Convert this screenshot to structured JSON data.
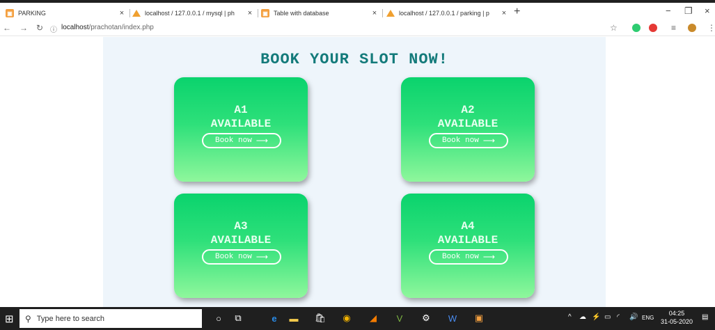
{
  "browser": {
    "tabs": [
      {
        "label": "PARKING",
        "icon": "page-favicon",
        "close": "×"
      },
      {
        "label": "localhost / 127.0.0.1 / mysql | ph",
        "icon": "phpmyadmin-favicon",
        "close": "×"
      },
      {
        "label": "Table with database",
        "icon": "page-favicon",
        "close": "×"
      },
      {
        "label": "localhost / 127.0.0.1 / parking | p",
        "icon": "phpmyadmin-favicon",
        "close": "×"
      }
    ],
    "new_tab": "+",
    "window_controls": {
      "minimize": "−",
      "maximize": "❐",
      "close": "×"
    },
    "address": {
      "host": "localhost",
      "path": "/prachotan/index.php"
    }
  },
  "page": {
    "heading": "BOOK YOUR SLOT NOW!",
    "slots": [
      {
        "id": "A1",
        "status": "AVAILABLE",
        "button": "Book now",
        "arrow": "⟶"
      },
      {
        "id": "A2",
        "status": "AVAILABLE",
        "button": "Book now",
        "arrow": "⟶"
      },
      {
        "id": "A3",
        "status": "AVAILABLE",
        "button": "Book now",
        "arrow": "⟶"
      },
      {
        "id": "A4",
        "status": "AVAILABLE",
        "button": "Book now",
        "arrow": "⟶"
      }
    ]
  },
  "taskbar": {
    "search_placeholder": "Type here to search",
    "language": "ENG",
    "time": "04:25",
    "date": "31-05-2020"
  },
  "colors": {
    "heading": "#137a7a",
    "card_top": "#0ad36d",
    "card_bottom": "#8ff79c",
    "page_bg": "#eef5fb"
  }
}
